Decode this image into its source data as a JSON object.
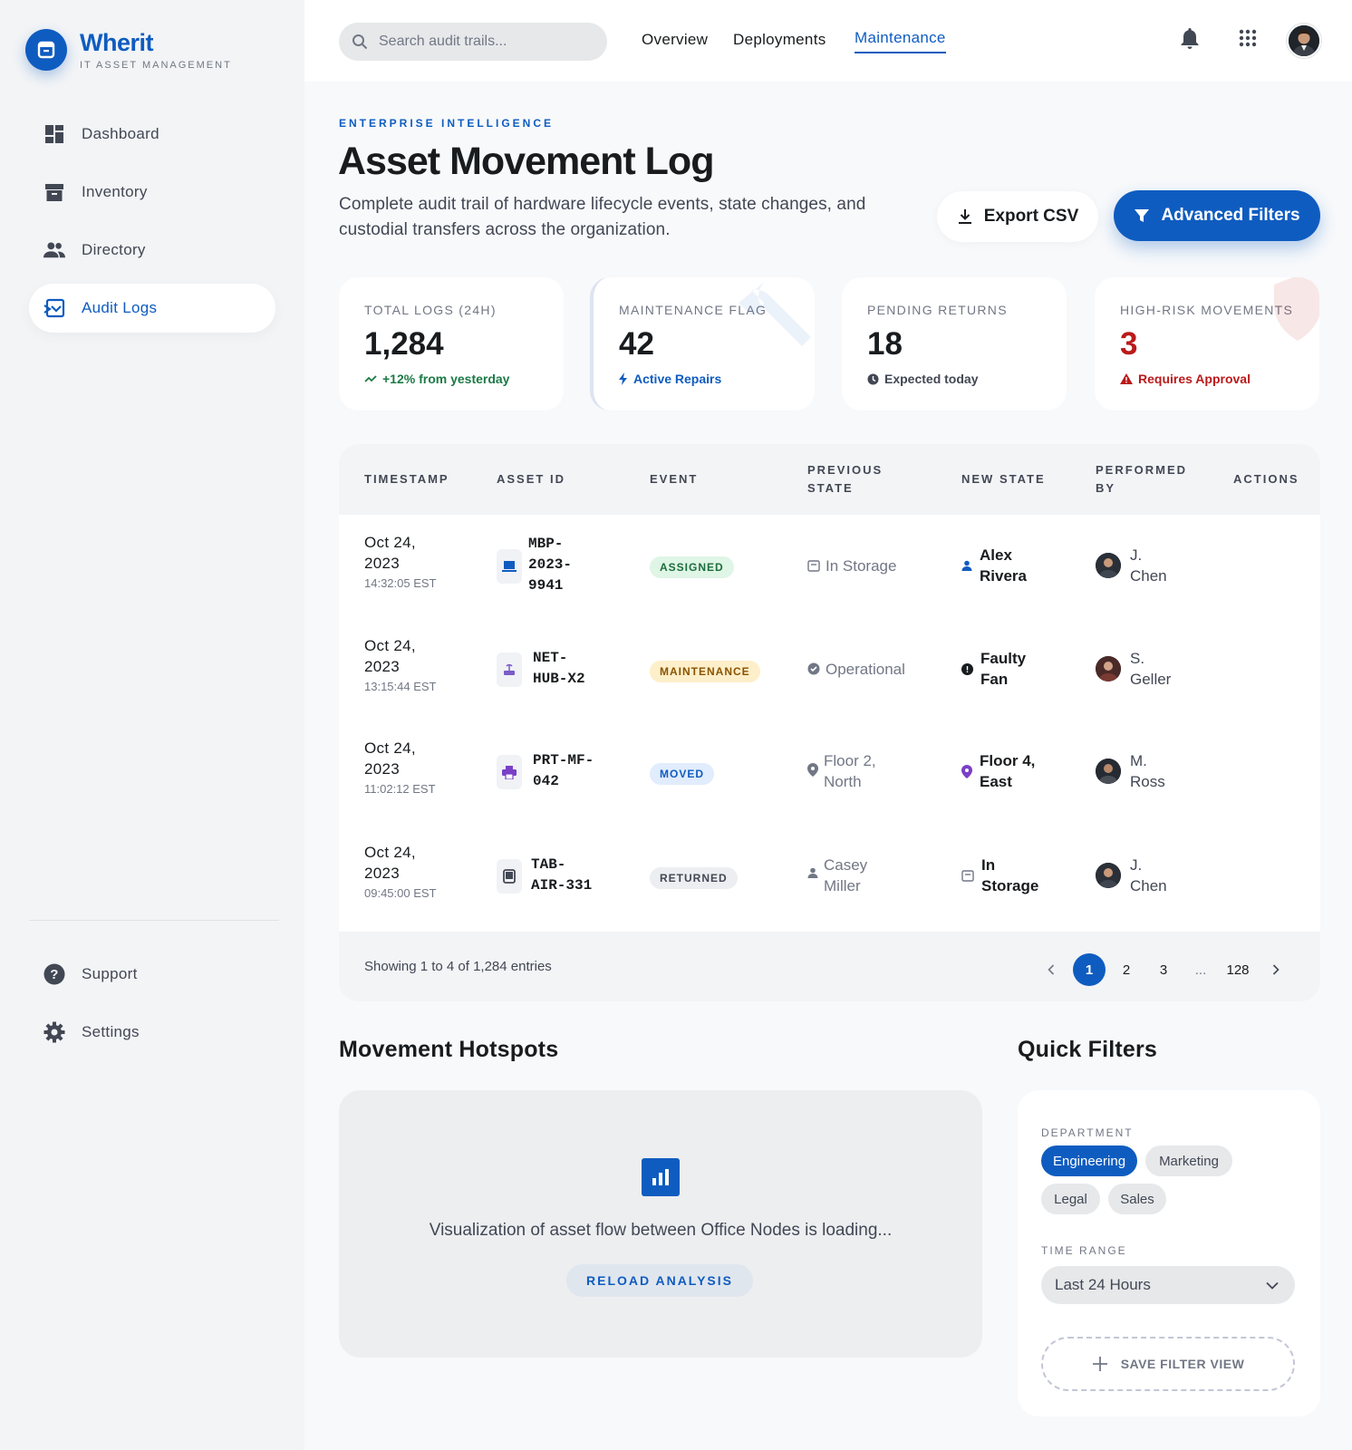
{
  "brand": {
    "name": "Wherit",
    "subtitle": "IT ASSET MANAGEMENT"
  },
  "sidebar": {
    "items": [
      {
        "label": "Dashboard",
        "icon": "dashboard-icon"
      },
      {
        "label": "Inventory",
        "icon": "inventory-icon"
      },
      {
        "label": "Directory",
        "icon": "people-icon"
      },
      {
        "label": "Audit Logs",
        "icon": "audit-icon",
        "active": true
      }
    ],
    "footer": [
      {
        "label": "Support",
        "icon": "help-icon"
      },
      {
        "label": "Settings",
        "icon": "gear-icon"
      }
    ]
  },
  "topbar": {
    "search_placeholder": "Search audit trails...",
    "nav": [
      "Overview",
      "Deployments",
      "Maintenance"
    ],
    "active_nav": "Maintenance"
  },
  "header": {
    "eyebrow": "ENTERPRISE INTELLIGENCE",
    "title": "Asset Movement Log",
    "description": "Complete audit trail of hardware lifecycle events, state changes, and custodial transfers across the organization.",
    "export_label": "Export CSV",
    "filters_label": "Advanced Filters"
  },
  "kpis": [
    {
      "label": "TOTAL LOGS (24H)",
      "value": "1,284",
      "sub": "+12% from yesterday",
      "sub_color": "#1b7a45"
    },
    {
      "label": "MAINTENANCE FLAG",
      "value": "42",
      "sub": "Active Repairs",
      "sub_color": "#0f5cc0"
    },
    {
      "label": "PENDING RETURNS",
      "value": "18",
      "sub": "Expected today",
      "sub_color": "#424754"
    },
    {
      "label": "HIGH-RISK MOVEMENTS",
      "value": "3",
      "sub": "Requires Approval",
      "sub_color": "#ba1a1a"
    }
  ],
  "table": {
    "headers": [
      "TIMESTAMP",
      "ASSET ID",
      "EVENT",
      "PREVIOUS STATE",
      "NEW STATE",
      "PERFORMED BY",
      "ACTIONS"
    ],
    "header_lines": {
      "prev": [
        "PREVIOUS",
        "STATE"
      ],
      "performed": [
        "PERFORMED",
        "BY"
      ]
    },
    "rows": [
      {
        "date": [
          "Oct 24,",
          "2023"
        ],
        "time": "14:32:05 EST",
        "asset": [
          "MBP-",
          "2023-",
          "9941"
        ],
        "event": "ASSIGNED",
        "prev": [
          "In Storage"
        ],
        "new": [
          "Alex",
          "Rivera"
        ],
        "by": [
          "J.",
          "Chen"
        ]
      },
      {
        "date": [
          "Oct 24,",
          "2023"
        ],
        "time": "13:15:44 EST",
        "asset": [
          "NET-",
          "HUB-X2"
        ],
        "event": "MAINTENANCE",
        "prev": [
          "Operational"
        ],
        "new": [
          "Faulty",
          "Fan"
        ],
        "by": [
          "S.",
          "Geller"
        ]
      },
      {
        "date": [
          "Oct 24,",
          "2023"
        ],
        "time": "11:02:12 EST",
        "asset": [
          "PRT-MF-",
          "042"
        ],
        "event": "MOVED",
        "prev": [
          "Floor 2,",
          "North"
        ],
        "new": [
          "Floor 4,",
          "East"
        ],
        "by": [
          "M.",
          "Ross"
        ]
      },
      {
        "date": [
          "Oct 24,",
          "2023"
        ],
        "time": "09:45:00 EST",
        "asset": [
          "TAB-",
          "AIR-331"
        ],
        "event": "RETURNED",
        "prev": [
          "Casey",
          "Miller"
        ],
        "new": [
          "In",
          "Storage"
        ],
        "by": [
          "J.",
          "Chen"
        ]
      }
    ],
    "footer_info": "Showing 1 to 4 of 1,284 entries",
    "pages": [
      "1",
      "2",
      "3",
      "...",
      "128"
    ]
  },
  "hotspots": {
    "title": "Movement Hotspots",
    "message": "Visualization of asset flow between Office Nodes is loading...",
    "reload_label": "RELOAD ANALYSIS"
  },
  "quick_filters": {
    "title": "Quick Filters",
    "department_label": "DEPARTMENT",
    "departments": [
      "Engineering",
      "Marketing",
      "Legal",
      "Sales"
    ],
    "time_label": "TIME RANGE",
    "time_value": "Last 24 Hours",
    "save_label": "SAVE FILTER VIEW"
  }
}
